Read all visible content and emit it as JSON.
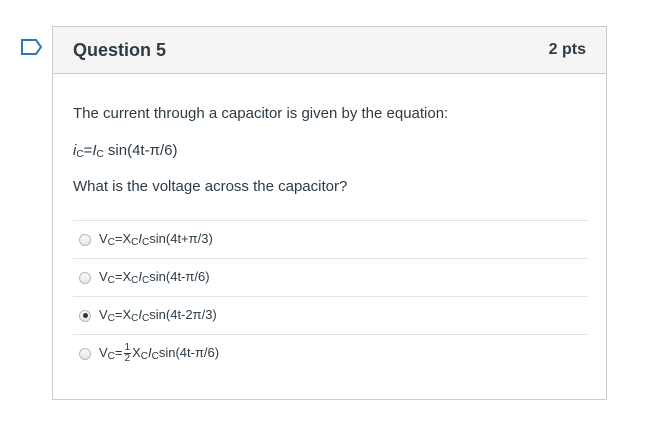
{
  "question": {
    "title": "Question 5",
    "points": "2 pts",
    "prompt_line1": "The current through a capacitor is given by the equation:",
    "equation": {
      "lhs_var": "i",
      "lhs_sub": "C",
      "eq": "=",
      "rhs_var": "I",
      "rhs_sub": "C",
      "rhs_rest": " sin(4t-π/6)"
    },
    "prompt_line2": "What is the voltage across the capacitor?"
  },
  "answers": [
    {
      "v": "V",
      "vsub": "C",
      "eq": "=X",
      "xsub": "C",
      "i": "I",
      "isub": "C",
      "rest": "sin(4t+π/3)",
      "selected": false
    },
    {
      "v": "V",
      "vsub": "C",
      "eq": "=X",
      "xsub": "C",
      "i": "I",
      "isub": "C",
      "rest": "sin(4t-π/6)",
      "selected": false
    },
    {
      "v": "V",
      "vsub": "C",
      "eq": "=X",
      "xsub": "C",
      "i": "I",
      "isub": "C",
      "rest": "sin(4t-2π/3)",
      "selected": true
    },
    {
      "v": "V",
      "vsub": "C",
      "eq": "=",
      "frac_num": "1",
      "frac_den": "2",
      "x": "X",
      "xsub": "C",
      "i": "I",
      "isub": "C",
      "rest": "sin(4t-π/6)",
      "selected": false
    }
  ],
  "colors": {
    "flag": "#2b7abc",
    "border": "#c7cdd1",
    "header_bg": "#f5f5f5",
    "text": "#2d3b45"
  },
  "icons": {
    "flag": "bookmark-flag-icon"
  }
}
